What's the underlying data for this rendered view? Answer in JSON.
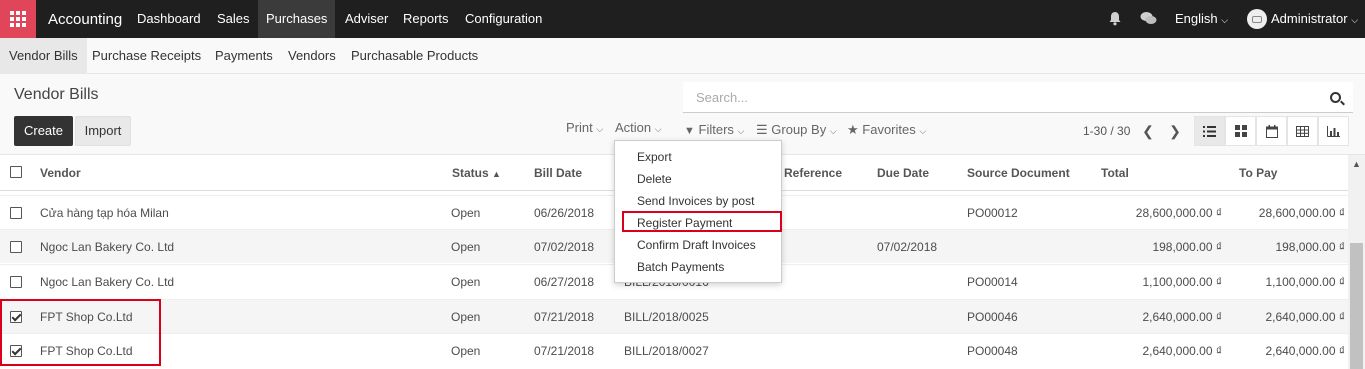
{
  "topbar": {
    "brand": "Accounting",
    "menu": [
      "Dashboard",
      "Sales",
      "Purchases",
      "Adviser",
      "Reports",
      "Configuration"
    ],
    "active_menu": "Purchases",
    "language": "English",
    "user": "Administrator"
  },
  "subnav": {
    "items": [
      "Vendor Bills",
      "Purchase Receipts",
      "Payments",
      "Vendors",
      "Purchasable Products"
    ],
    "active": "Vendor Bills"
  },
  "control": {
    "title": "Vendor Bills",
    "create_label": "Create",
    "import_label": "Import",
    "search_placeholder": "Search...",
    "print_label": "Print",
    "action_label": "Action",
    "filters_label": "Filters",
    "groupby_label": "Group By",
    "favorites_label": "Favorites",
    "pager": "1-30 / 30"
  },
  "table": {
    "headers": {
      "vendor": "Vendor",
      "status": "Status",
      "bill_date": "Bill Date",
      "reference": "Reference",
      "due_date": "Due Date",
      "source": "Source Document",
      "total": "Total",
      "to_pay": "To Pay"
    },
    "rows": [
      {
        "vendor": "Cửa hàng tạp hóa Milan",
        "status": "Open",
        "bill_date": "06/26/2018",
        "number": "",
        "due_date": "",
        "source": "PO00012",
        "total": "28,600,000.00 ₫",
        "to_pay": "28,600,000.00 ₫",
        "checked": false
      },
      {
        "vendor": "Ngoc Lan Bakery Co. Ltd",
        "status": "Open",
        "bill_date": "07/02/2018",
        "number": "",
        "due_date": "07/02/2018",
        "source": "",
        "total": "198,000.00 ₫",
        "to_pay": "198,000.00 ₫",
        "checked": false
      },
      {
        "vendor": "Ngoc Lan Bakery Co. Ltd",
        "status": "Open",
        "bill_date": "06/27/2018",
        "number": "BILL/2018/0016",
        "due_date": "",
        "source": "PO00014",
        "total": "1,100,000.00 ₫",
        "to_pay": "1,100,000.00 ₫",
        "checked": false
      },
      {
        "vendor": "FPT Shop Co.Ltd",
        "status": "Open",
        "bill_date": "07/21/2018",
        "number": "BILL/2018/0025",
        "due_date": "",
        "source": "PO00046",
        "total": "2,640,000.00 ₫",
        "to_pay": "2,640,000.00 ₫",
        "checked": true
      },
      {
        "vendor": "FPT Shop Co.Ltd",
        "status": "Open",
        "bill_date": "07/21/2018",
        "number": "BILL/2018/0027",
        "due_date": "",
        "source": "PO00048",
        "total": "2,640,000.00 ₫",
        "to_pay": "2,640,000.00 ₫",
        "checked": true
      }
    ]
  },
  "action_menu": {
    "items": [
      "Export",
      "Delete",
      "Send Invoices by post",
      "Register Payment",
      "Confirm Draft Invoices",
      "Batch Payments"
    ],
    "highlighted": "Register Payment"
  },
  "colors": {
    "topbar": "#1f1f1f",
    "app_icon": "#e0455a",
    "highlight": "#d9001b"
  }
}
